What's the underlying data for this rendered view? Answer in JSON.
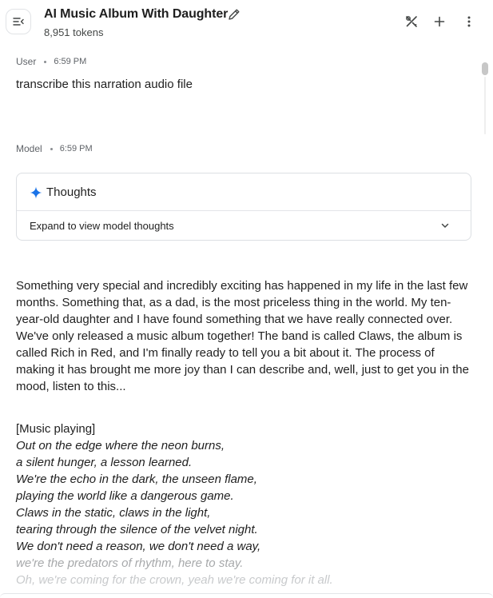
{
  "header": {
    "title": "AI Music Album With Daughter",
    "tokens": "8,951 tokens",
    "icons": [
      "menu-collapse-icon",
      "edit-icon",
      "tools-icon",
      "plus-icon",
      "more-vert-icon"
    ]
  },
  "user_turn": {
    "role": "User",
    "time": "6:59 PM",
    "text": "transcribe this narration audio file"
  },
  "model_turn": {
    "role": "Model",
    "time": "6:59 PM",
    "thoughts": {
      "title": "Thoughts",
      "expand_label": "Expand to view model thoughts"
    },
    "narration": "Something very special and incredibly exciting has happened in my life in the last few months. Something that, as a dad, is the most priceless thing in the world. My ten-year-old daughter and I have found something that we have really connected over. We've only released a music album together! The band is called Claws, the album is called Rich in Red, and I'm finally ready to tell you a bit about it. The process of making it has brought me more joy than I can describe and, well, just to get you in the mood, listen to this...",
    "music_tag": "[Music playing]",
    "lyrics": [
      "Out on the edge where the neon burns,",
      "a silent hunger, a lesson learned.",
      "We're the echo in the dark, the unseen flame,",
      "playing the world like a dangerous game.",
      "Claws in the static, claws in the light,",
      "tearing through the silence of the velvet night.",
      "We don't need a reason, we don't need a way,",
      "we're the predators of rhythm, here to stay.",
      "Oh, we're coming for the crown, yeah we're coming for it all."
    ]
  },
  "colors": {
    "accent": "#1a73e8",
    "text": "#1f1f1f",
    "muted": "#5f6368",
    "border": "#dcdfe3"
  }
}
